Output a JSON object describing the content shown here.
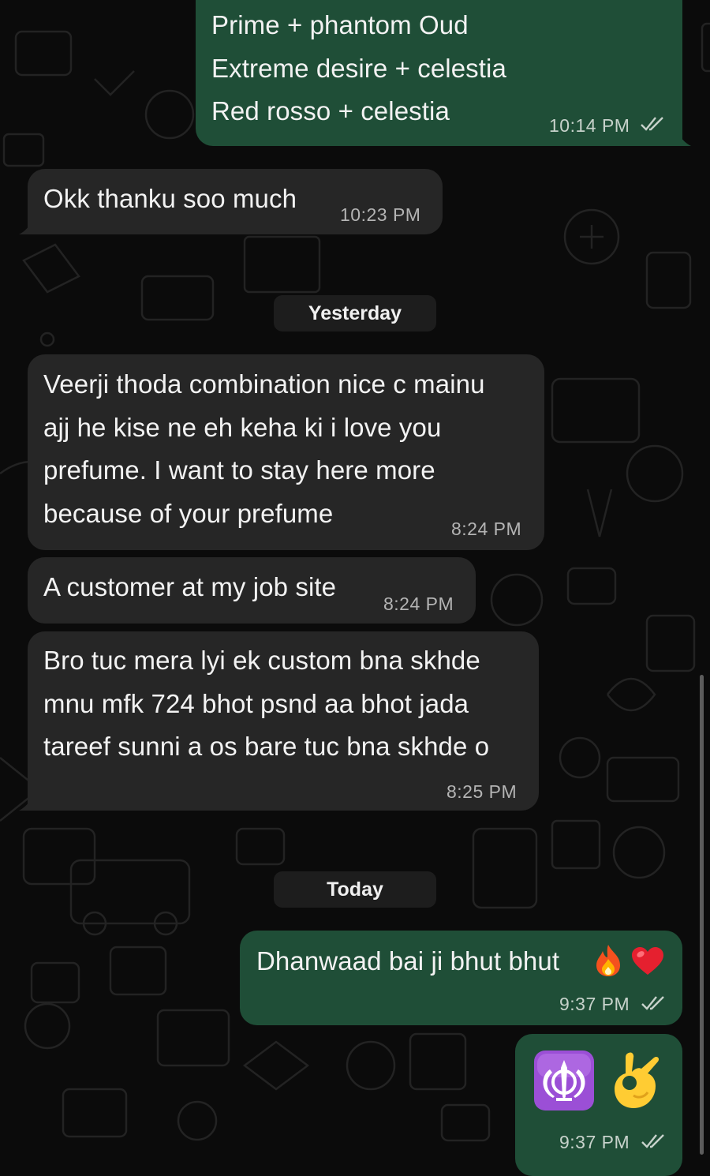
{
  "chat": {
    "messages": [
      {
        "id": "m1",
        "direction": "outgoing",
        "text": "Prime  + phantom Oud\nExtreme desire + celestia\nRed rosso + celestia",
        "time": "10:14 PM",
        "status": "read"
      },
      {
        "id": "m2",
        "direction": "incoming",
        "text": "Okk thanku soo much",
        "time": "10:23 PM"
      },
      {
        "id": "m3",
        "direction": "incoming",
        "text": "Veerji thoda combination nice c mainu\najj he kise ne eh keha ki i love you\nprefume. I want to stay here more\nbecause of your prefume",
        "time": "8:24 PM"
      },
      {
        "id": "m4",
        "direction": "incoming",
        "text": "A customer at my job site",
        "time": "8:24 PM"
      },
      {
        "id": "m5",
        "direction": "incoming",
        "text": "Bro tuc mera lyi ek custom bna skhde\nmnu mfk 724 bhot psnd aa bhot jada\ntareef sunni a os bare tuc bna skhde o",
        "time": "8:25 PM"
      },
      {
        "id": "m6",
        "direction": "outgoing",
        "text": "Dhanwaad bai ji bhut bhut",
        "emoji": [
          "fire",
          "red-heart"
        ],
        "time": "9:37 PM",
        "status": "read"
      },
      {
        "id": "m7",
        "direction": "outgoing",
        "emoji": [
          "khanda",
          "ok-hand"
        ],
        "time": "9:37 PM",
        "status": "read"
      }
    ],
    "dividers": [
      "Yesterday",
      "Today"
    ]
  },
  "colors": {
    "background": "#0b0b0b",
    "incoming_bubble": "#262626",
    "outgoing_bubble": "#1f4e37",
    "divider_bg": "#1d1d1d",
    "read_ticks": "#c7d2cb"
  }
}
